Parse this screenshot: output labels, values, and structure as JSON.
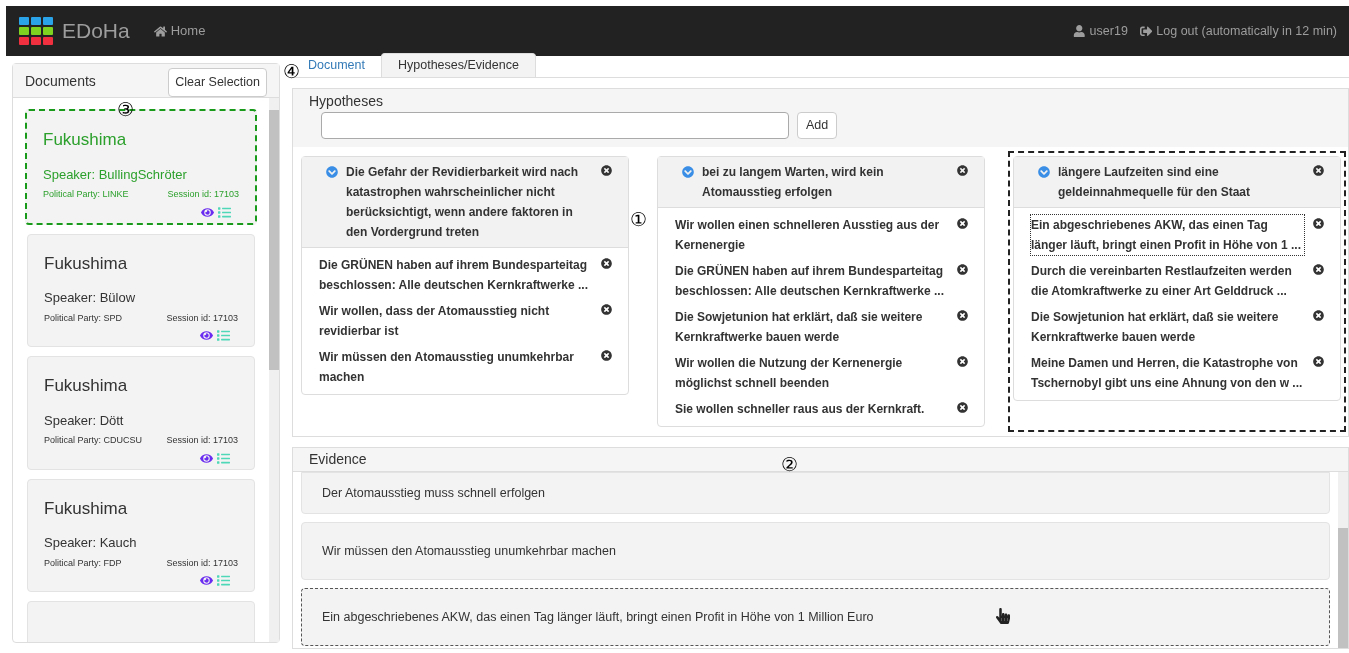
{
  "navbar": {
    "brand": "EDoHa",
    "home": "Home",
    "user": "user19",
    "logout": "Log out (automatically in 12 min)"
  },
  "documents": {
    "title": "Documents",
    "clear_button": "Clear Selection",
    "items": [
      {
        "title": "Fukushima",
        "speaker": "Speaker: BullingSchröter",
        "party": "Political Party: LINKE",
        "session": "Session id: 17103",
        "selected": true
      },
      {
        "title": "Fukushima",
        "speaker": "Speaker: Bülow",
        "party": "Political Party: SPD",
        "session": "Session id: 17103",
        "selected": false
      },
      {
        "title": "Fukushima",
        "speaker": "Speaker: Dött",
        "party": "Political Party: CDUCSU",
        "session": "Session id: 17103",
        "selected": false
      },
      {
        "title": "Fukushima",
        "speaker": "Speaker: Kauch",
        "party": "Political Party: FDP",
        "session": "Session id: 17103",
        "selected": false
      }
    ]
  },
  "tabs": [
    {
      "label": "Document",
      "selected": false
    },
    {
      "label": "Hypotheses/Evidence",
      "selected": true
    }
  ],
  "hypotheses": {
    "title": "Hypotheses",
    "add_button": "Add",
    "columns": [
      {
        "title": "Die Gefahr der Revidierbarkeit wird nach katastrophen wahrscheinlicher nicht berücksichtigt, wenn andere faktoren in den Vordergrund treten",
        "selected": false,
        "evidence": [
          {
            "text": "Die GRÜNEN haben auf ihrem Bundesparteitag beschlossen: Alle deutschen Kernkraftwerke ...",
            "selected": false
          },
          {
            "text": "Wir wollen, dass der Atomausstieg nicht revidierbar ist",
            "selected": false
          },
          {
            "text": "Wir müssen den Atomausstieg unumkehrbar machen",
            "selected": false
          }
        ]
      },
      {
        "title": "bei zu langem Warten, wird kein Atomausstieg erfolgen",
        "selected": false,
        "evidence": [
          {
            "text": "Wir wollen einen schnelleren Ausstieg aus der Kernenergie",
            "selected": false
          },
          {
            "text": "Die GRÜNEN haben auf ihrem Bundesparteitag beschlossen: Alle deutschen Kernkraftwerke ...",
            "selected": false
          },
          {
            "text": "Die Sowjetunion hat erklärt, daß sie weitere Kernkraftwerke bauen werde",
            "selected": false
          },
          {
            "text": "Wir wollen die Nutzung der Kernenergie möglichst schnell beenden",
            "selected": false
          },
          {
            "text": "Sie wollen schneller raus aus der Kernkraft.",
            "selected": false
          }
        ]
      },
      {
        "title": "längere Laufzeiten sind eine geldeinnahmequelle für den Staat",
        "selected": true,
        "evidence": [
          {
            "text": "Ein abgeschriebenes AKW, das einen Tag länger läuft, bringt einen Profit in Höhe von 1 ...",
            "selected": true
          },
          {
            "text": "Durch die vereinbarten Restlaufzeiten werden die Atomkraftwerke zu einer Art Gelddruck ...",
            "selected": false
          },
          {
            "text": "Die Sowjetunion hat erklärt, daß sie weitere Kernkraftwerke bauen werde",
            "selected": false
          },
          {
            "text": "Meine Damen und Herren, die Katastrophe von Tschernobyl gibt uns eine Ahnung von den w ...",
            "selected": false
          }
        ]
      }
    ]
  },
  "evidence": {
    "title": "Evidence",
    "items": [
      {
        "text": "Der Atomausstieg muss schnell erfolgen",
        "selected": false
      },
      {
        "text": "Wir müssen den Atomausstieg unumkehrbar machen",
        "selected": false
      },
      {
        "text": "Ein abgeschriebenes AKW, das einen Tag länger läuft, bringt einen Profit in Höhe von 1 Million Euro",
        "selected": true
      }
    ]
  },
  "annotations": [
    "①",
    "②",
    "③",
    "④"
  ]
}
